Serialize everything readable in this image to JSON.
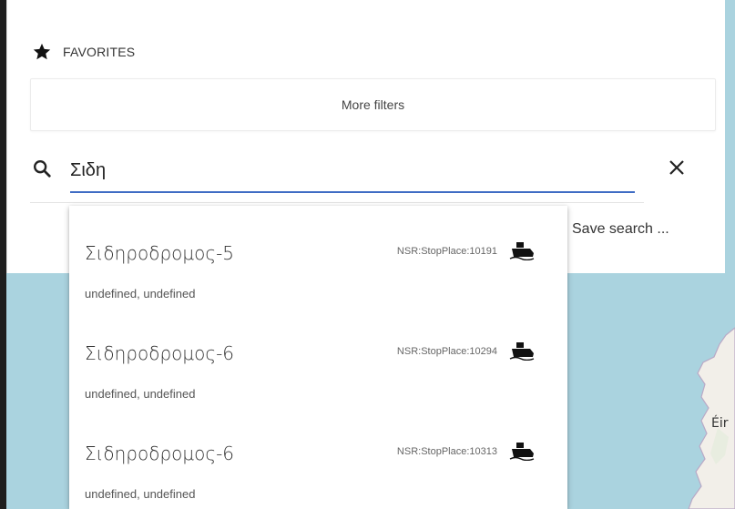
{
  "map": {
    "label": "Éir",
    "water_color": "#aad3df",
    "land_color": "#f2efe9"
  },
  "favorites": {
    "label": "FAVORITES",
    "icon": "star-icon"
  },
  "filters": {
    "more_label": "More filters"
  },
  "search": {
    "value": "Σιδη",
    "icon": "search-icon",
    "clear_icon": "close-icon",
    "accent": "#3f6cc4"
  },
  "save_search": {
    "label": "Save search ..."
  },
  "results": [
    {
      "name": "Σιδηροδρομος-5",
      "id": "NSR:StopPlace:10191",
      "sub": "undefined, undefined",
      "icon": "ferry-icon"
    },
    {
      "name": "Σιδηροδρομος-6",
      "id": "NSR:StopPlace:10294",
      "sub": "undefined, undefined",
      "icon": "ferry-icon"
    },
    {
      "name": "Σιδηροδρομος-6",
      "id": "NSR:StopPlace:10313",
      "sub": "undefined, undefined",
      "icon": "ferry-icon"
    }
  ]
}
